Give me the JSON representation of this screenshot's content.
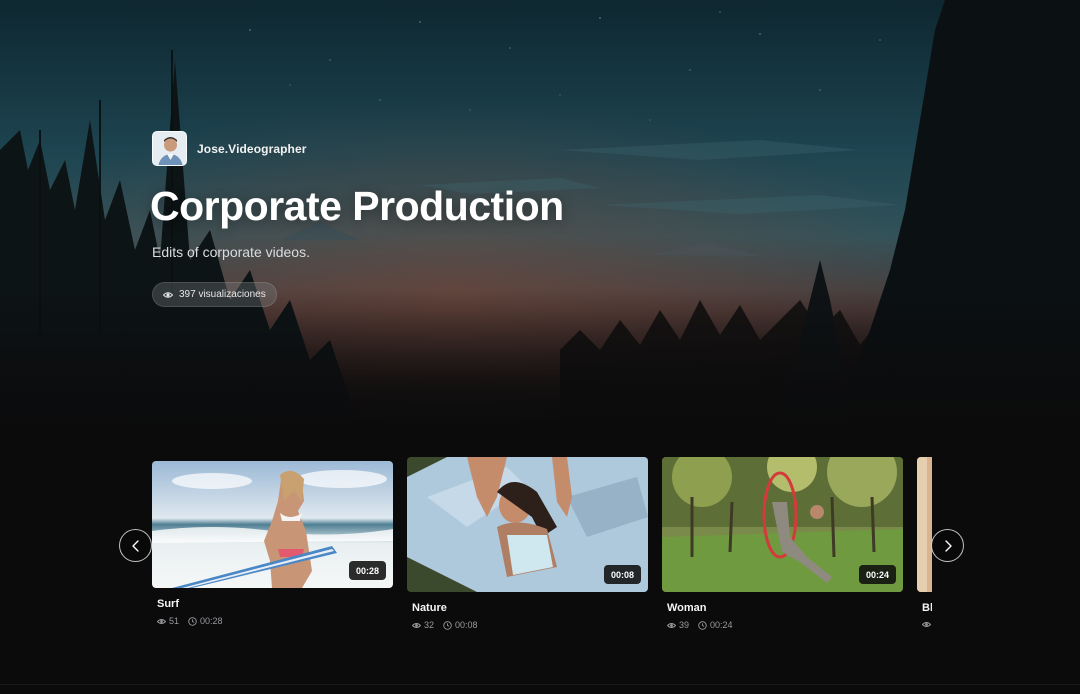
{
  "author": {
    "name": "Jose.Videographer",
    "avatar_icon": "avatar-photo"
  },
  "collection": {
    "title": "Corporate Production",
    "description": "Edits of corporate videos.",
    "views_label": "397 visualizaciones"
  },
  "carousel": {
    "prev_icon": "chevron-left-icon",
    "next_icon": "chevron-right-icon",
    "videos": [
      {
        "title": "Surf",
        "duration": "00:28",
        "views": "51",
        "length": "00:28"
      },
      {
        "title": "Nature",
        "duration": "00:08",
        "views": "32",
        "length": "00:08"
      },
      {
        "title": "Woman",
        "duration": "00:24",
        "views": "39",
        "length": "00:24"
      },
      {
        "title": "Bl",
        "duration": "",
        "views": "",
        "length": ""
      }
    ]
  },
  "colors": {
    "background": "#0b0b0c",
    "sky_top": "#0f2a32",
    "accent_text": "#ffffff"
  }
}
